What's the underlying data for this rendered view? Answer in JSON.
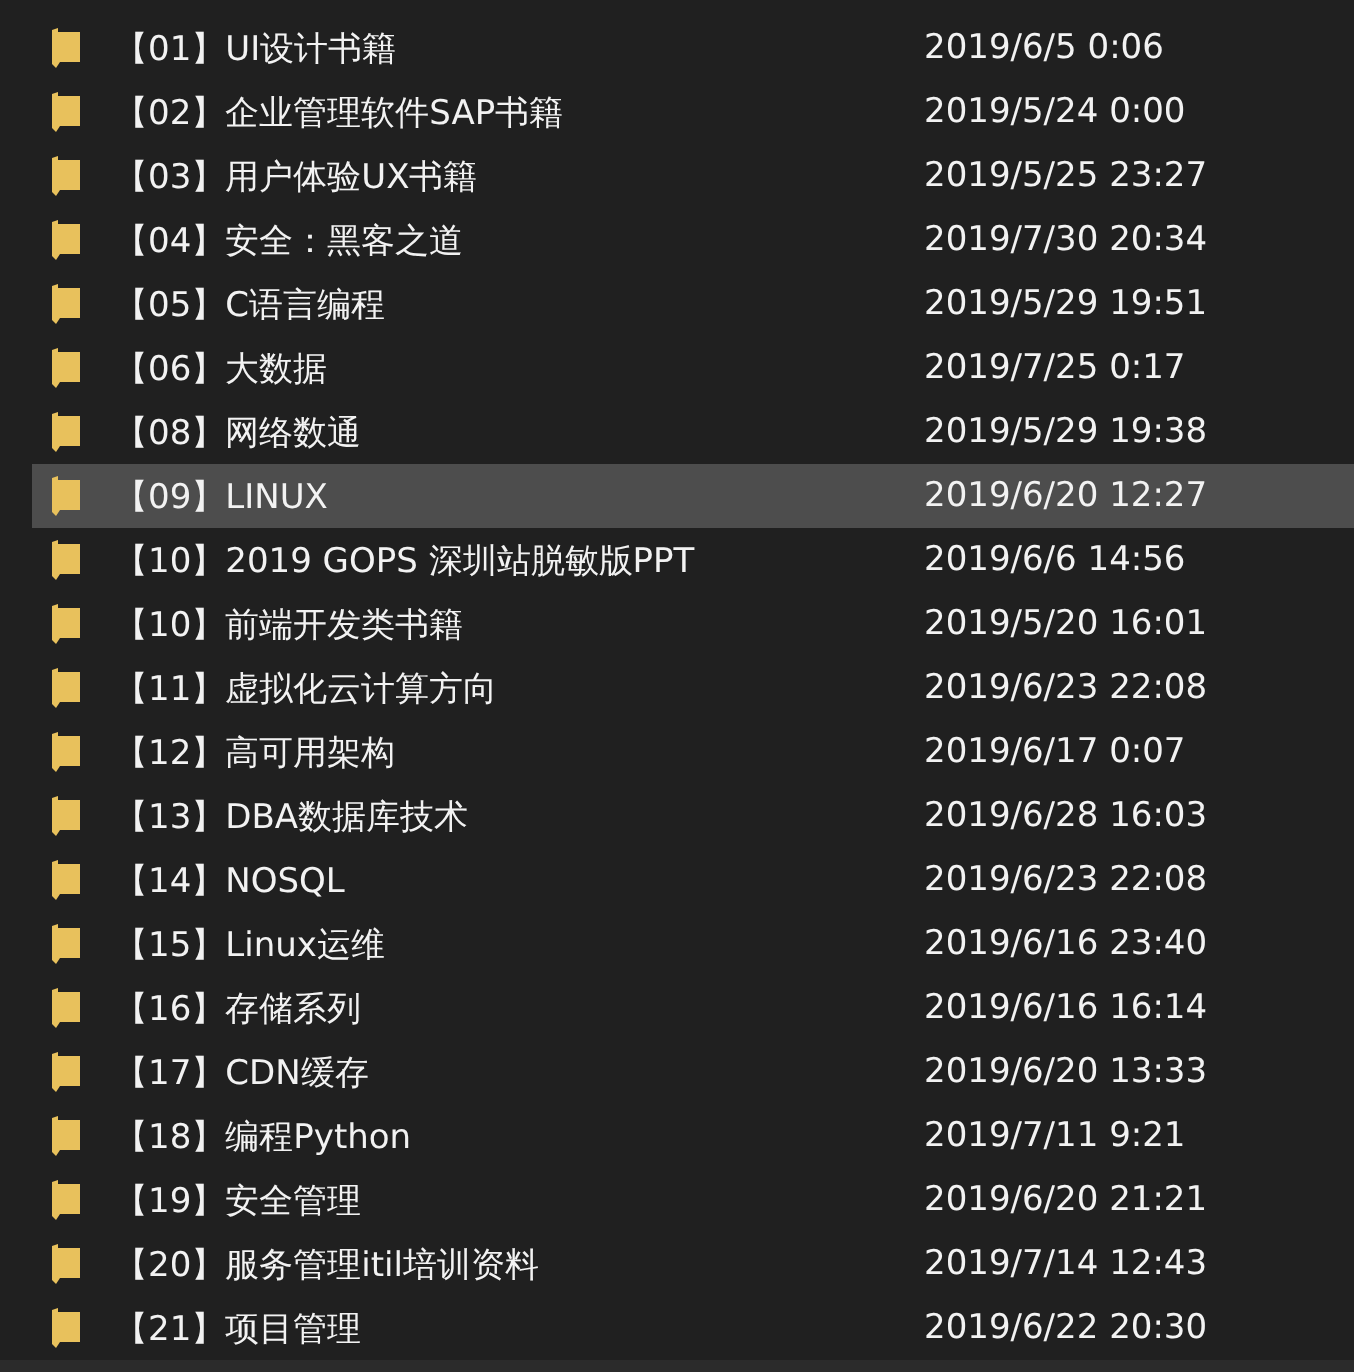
{
  "files": [
    {
      "name": "【01】UI设计书籍",
      "modified": "2019/6/5 0:06",
      "selected": false
    },
    {
      "name": "【02】企业管理软件SAP书籍",
      "modified": "2019/5/24 0:00",
      "selected": false
    },
    {
      "name": "【03】用户体验UX书籍",
      "modified": "2019/5/25 23:27",
      "selected": false
    },
    {
      "name": "【04】安全：黑客之道",
      "modified": "2019/7/30 20:34",
      "selected": false
    },
    {
      "name": "【05】C语言编程",
      "modified": "2019/5/29 19:51",
      "selected": false
    },
    {
      "name": "【06】大数据",
      "modified": "2019/7/25 0:17",
      "selected": false
    },
    {
      "name": "【08】网络数通",
      "modified": "2019/5/29 19:38",
      "selected": false
    },
    {
      "name": "【09】LINUX",
      "modified": "2019/6/20 12:27",
      "selected": true
    },
    {
      "name": "【10】2019 GOPS 深圳站脱敏版PPT",
      "modified": "2019/6/6 14:56",
      "selected": false
    },
    {
      "name": "【10】前端开发类书籍",
      "modified": "2019/5/20 16:01",
      "selected": false
    },
    {
      "name": "【11】虚拟化云计算方向",
      "modified": "2019/6/23 22:08",
      "selected": false
    },
    {
      "name": "【12】高可用架构",
      "modified": "2019/6/17 0:07",
      "selected": false
    },
    {
      "name": "【13】DBA数据库技术",
      "modified": "2019/6/28 16:03",
      "selected": false
    },
    {
      "name": "【14】NOSQL",
      "modified": "2019/6/23 22:08",
      "selected": false
    },
    {
      "name": "【15】Linux运维",
      "modified": "2019/6/16 23:40",
      "selected": false
    },
    {
      "name": "【16】存储系列",
      "modified": "2019/6/16 16:14",
      "selected": false
    },
    {
      "name": "【17】CDN缓存",
      "modified": "2019/6/20 13:33",
      "selected": false
    },
    {
      "name": "【18】编程Python",
      "modified": "2019/7/11 9:21",
      "selected": false
    },
    {
      "name": "【19】安全管理",
      "modified": "2019/6/20 21:21",
      "selected": false
    },
    {
      "name": "【20】服务管理itil培训资料",
      "modified": "2019/7/14 12:43",
      "selected": false
    },
    {
      "name": "【21】项目管理",
      "modified": "2019/6/22 20:30",
      "selected": false
    }
  ]
}
